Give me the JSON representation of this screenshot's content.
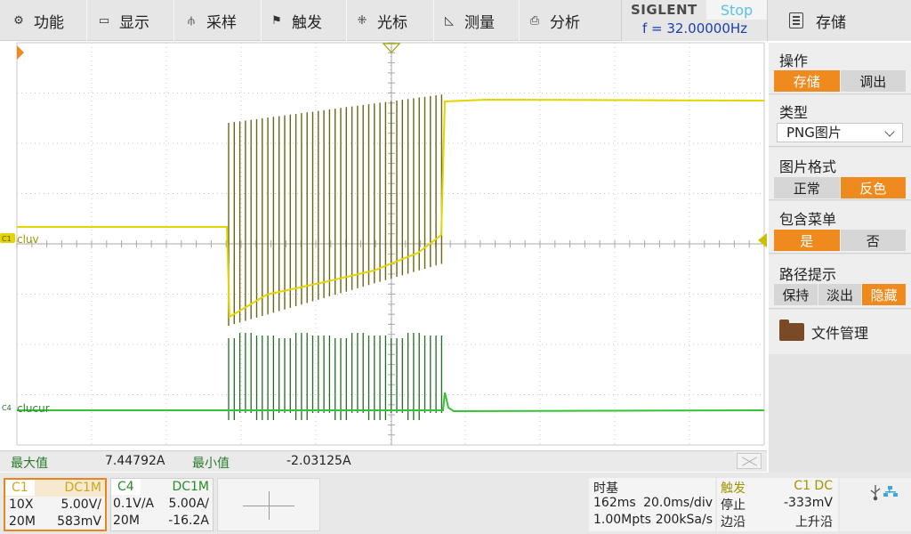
{
  "menu": {
    "items": [
      {
        "label": "功能",
        "icon": "gear-icon",
        "glyph": "⚙"
      },
      {
        "label": "显示",
        "icon": "display-icon",
        "glyph": "▭"
      },
      {
        "label": "采样",
        "icon": "sampling-icon",
        "glyph": "⫛"
      },
      {
        "label": "触发",
        "icon": "trigger-flag-icon",
        "glyph": "⚑"
      },
      {
        "label": "光标",
        "icon": "cursor-grid-icon",
        "glyph": "⁜"
      },
      {
        "label": "测量",
        "icon": "measure-icon",
        "glyph": "◺"
      },
      {
        "label": "分析",
        "icon": "analysis-icon",
        "glyph": "⎙"
      }
    ]
  },
  "brand": {
    "logo": "SIGLENT",
    "run_state": "Stop",
    "frequency": "f = 32.00000Hz"
  },
  "panel": {
    "title": "存储",
    "operation": {
      "title": "操作",
      "options": [
        "存储",
        "调出"
      ],
      "selected": 0
    },
    "type": {
      "title": "类型",
      "value": "PNG图片"
    },
    "image_format": {
      "title": "图片格式",
      "options": [
        "正常",
        "反色"
      ],
      "selected": 1
    },
    "include_menu": {
      "title": "包含菜单",
      "options": [
        "是",
        "否"
      ],
      "selected": 0
    },
    "path_hint": {
      "title": "路径提示",
      "options": [
        "保持",
        "淡出",
        "隐藏"
      ],
      "selected": 2
    },
    "file_manager": "文件管理"
  },
  "waveform": {
    "channels": [
      {
        "tag": "C1",
        "name": "cluv",
        "color": "#e5d400"
      },
      {
        "tag": "C4",
        "name": "clucur",
        "color": "#35c335"
      }
    ],
    "colors": {
      "grid": "#c8c8c8",
      "pulse_c1": "#6b6515",
      "pulse_c4": "#236b23"
    }
  },
  "measurements": {
    "max_label": "最大值",
    "max_value": "7.44792A",
    "min_label": "最小值",
    "min_value": "-2.03125A"
  },
  "channel_c1": {
    "tag": "C1",
    "coupling": "DC1M",
    "probe": "10X",
    "scale": "5.00V/",
    "bandwidth": "20M",
    "offset": "583mV"
  },
  "channel_c4": {
    "tag": "C4",
    "coupling": "DC1M",
    "probe": "0.1V/A",
    "scale": "5.00A/",
    "bandwidth": "20M",
    "offset": "-16.2A"
  },
  "timebase": {
    "title": "时基",
    "delay": "162ms",
    "scale": "20.0ms/div",
    "depth": "1.00Mpts",
    "rate": "200kSa/s"
  },
  "trigger": {
    "title": "触发",
    "source": "C1 DC",
    "state": "停止",
    "level": "-333mV",
    "edge_label": "边沿",
    "slope": "上升沿"
  }
}
